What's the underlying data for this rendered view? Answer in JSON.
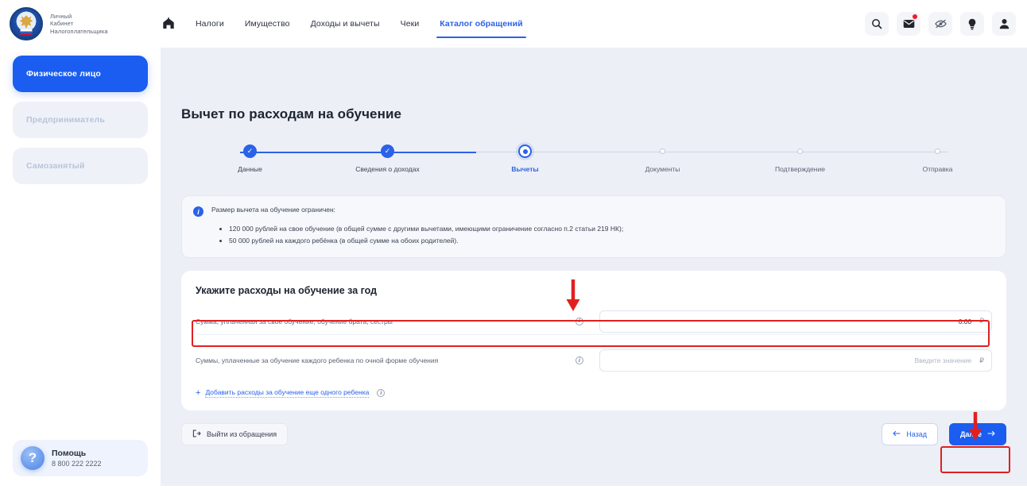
{
  "brand": {
    "line1": "Личный",
    "line2": "Кабинет",
    "line3": "Налогоплательщика",
    "emblem_icon": "russia-coat-of-arms-icon"
  },
  "topnav": {
    "home_icon": "home-icon",
    "items": [
      {
        "label": "Налоги",
        "active": false
      },
      {
        "label": "Имущество",
        "active": false
      },
      {
        "label": "Доходы и вычеты",
        "active": false
      },
      {
        "label": "Чеки",
        "active": false
      },
      {
        "label": "Каталог обращений",
        "active": true
      }
    ],
    "actions": [
      {
        "name": "search-icon",
        "badge": false
      },
      {
        "name": "mail-icon",
        "badge": true
      },
      {
        "name": "eye-off-icon",
        "badge": false
      },
      {
        "name": "lightbulb-icon",
        "badge": false
      },
      {
        "name": "profile-icon",
        "badge": false
      }
    ]
  },
  "sidebar": {
    "items": [
      {
        "label": "Физическое лицо",
        "state": "active"
      },
      {
        "label": "Предприниматель",
        "state": "muted"
      },
      {
        "label": "Самозанятый",
        "state": "muted"
      }
    ],
    "help": {
      "icon": "question-mark-icon",
      "title": "Помощь",
      "phone": "8 800 222 2222"
    }
  },
  "main": {
    "page_title": "Вычет по расходам на обучение",
    "steps": [
      {
        "label": "Данные",
        "state": "done"
      },
      {
        "label": "Сведения о доходах",
        "state": "done"
      },
      {
        "label": "Вычеты",
        "state": "current"
      },
      {
        "label": "Документы",
        "state": "todo"
      },
      {
        "label": "Подтверждение",
        "state": "todo"
      },
      {
        "label": "Отправка",
        "state": "todo"
      }
    ],
    "notice": {
      "icon": "info-icon",
      "heading": "Размер вычета на обучение ограничен:",
      "bullets": [
        "120 000 рублей на свое обучение (в общей сумме с другими вычетами, имеющими ограничение согласно п.2 статьи 219 НК);",
        "50 000 рублей на каждого ребёнка (в общей сумме на обоих родителей)."
      ]
    },
    "card": {
      "title": "Укажите расходы на обучение за год",
      "rows": [
        {
          "label": "Сумма, уплаченная за свое обучение, обучение брата, сестры",
          "info_icon": "info-circle-icon",
          "value": "0.00",
          "placeholder": "",
          "currency": "₽",
          "highlighted": true
        },
        {
          "label": "Суммы, уплаченные за обучение каждого ребенка по очной форме обучения",
          "info_icon": "info-circle-icon",
          "value": "",
          "placeholder": "Введите значение",
          "currency": "₽",
          "highlighted": false
        }
      ],
      "add_link": {
        "plus": "+",
        "label": "Добавить расходы за обучение еще одного ребенка",
        "info_icon": "info-circle-icon"
      }
    },
    "footer": {
      "exit_icon": "exit-icon",
      "exit_label": "Выйти из обращения",
      "back_icon": "arrow-left-icon",
      "back_label": "Назад",
      "next_label": "Далее",
      "next_icon": "arrow-right-icon"
    }
  },
  "annotations": {
    "color": "#e02020",
    "items": [
      {
        "name": "highlight-box-amount-field",
        "kind": "box"
      },
      {
        "name": "arrow-to-amount-field",
        "kind": "arrow-down"
      },
      {
        "name": "highlight-box-next-button",
        "kind": "box"
      },
      {
        "name": "arrow-to-next-button",
        "kind": "arrow-down"
      }
    ]
  }
}
